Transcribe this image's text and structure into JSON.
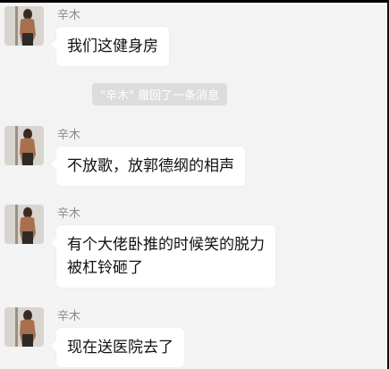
{
  "messages": [
    {
      "sender": "辛木",
      "text": "我们这健身房"
    },
    {
      "sender": "辛木",
      "text": "不放歌，放郭德纲的相声"
    },
    {
      "sender": "辛木",
      "line1": "有个大佬卧推的时候笑的脱力",
      "line2": "被杠铃砸了"
    },
    {
      "sender": "辛木",
      "text": "现在送医院去了"
    }
  ],
  "recall_notice": {
    "name": "\"辛木\"",
    "text": " 撤回了一条消息"
  }
}
